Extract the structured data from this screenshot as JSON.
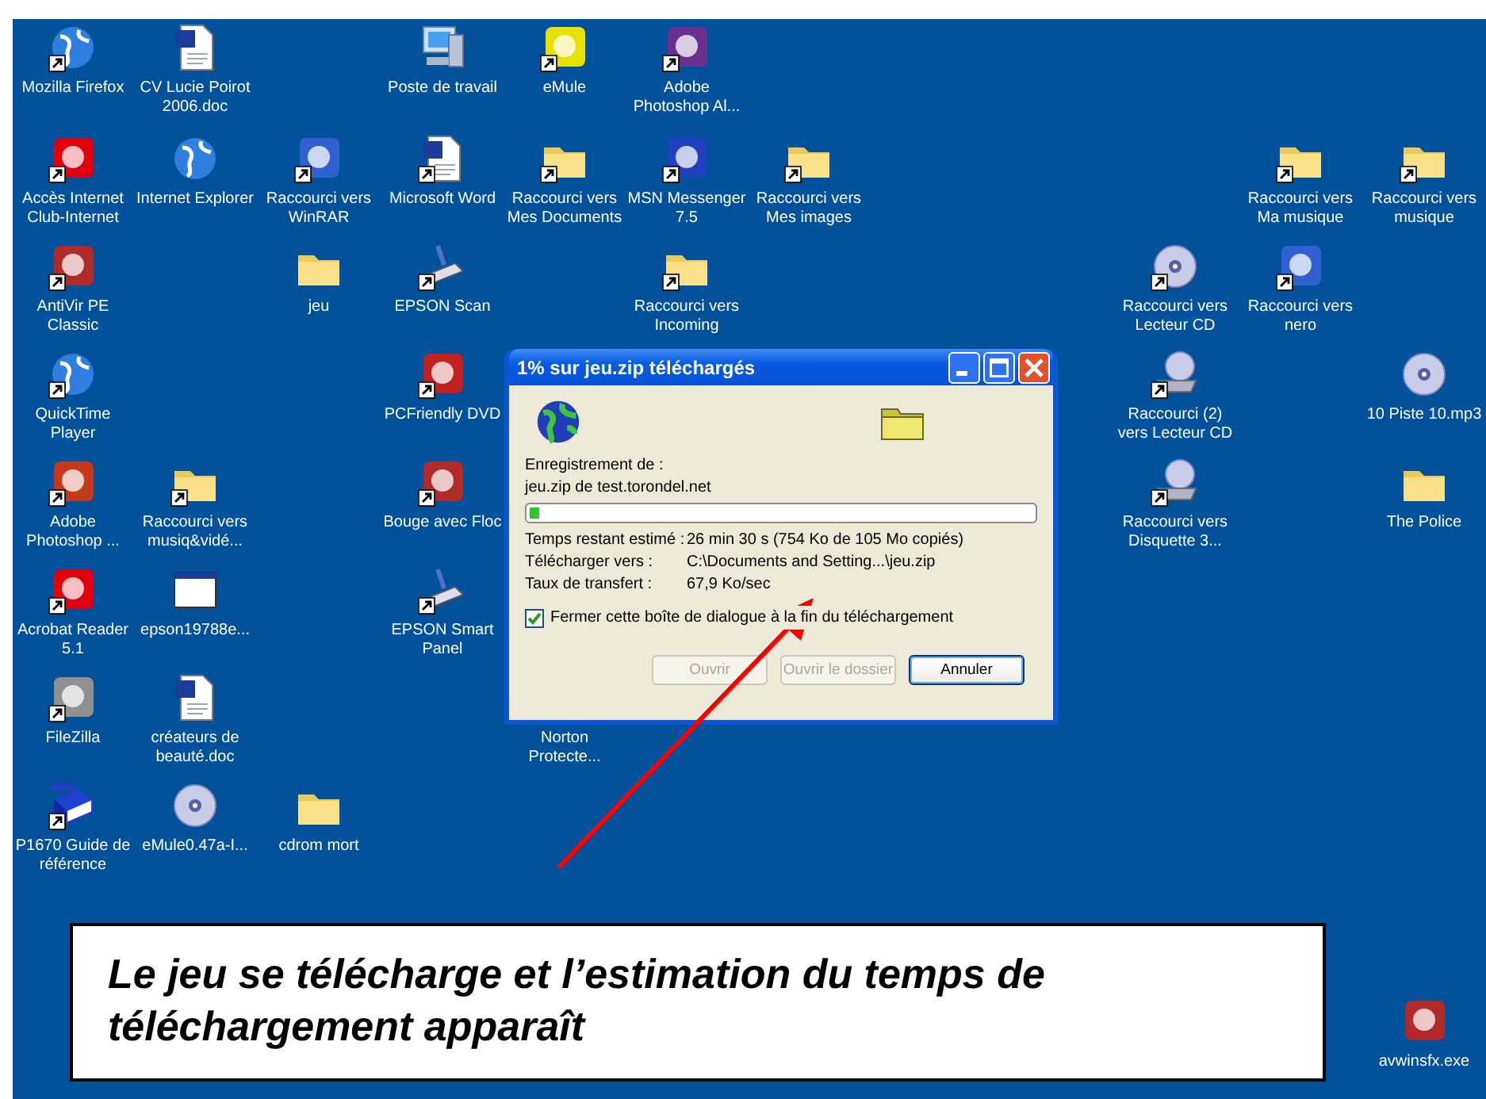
{
  "desktop_icons": [
    {
      "label": "Mozilla Firefox",
      "kind": "globe",
      "shortcut": true
    },
    {
      "label": "CV Lucie Poirot 2006.doc",
      "kind": "document",
      "shortcut": false
    },
    {
      "label": "Poste de travail",
      "kind": "computer",
      "shortcut": false
    },
    {
      "label": "eMule",
      "kind": "application",
      "shortcut": true
    },
    {
      "label": "Adobe Photoshop Al...",
      "kind": "application",
      "shortcut": true
    },
    {
      "label": "Accès Internet Club-Internet",
      "kind": "application",
      "shortcut": true
    },
    {
      "label": "Internet Explorer",
      "kind": "globe",
      "shortcut": false
    },
    {
      "label": "Raccourci vers WinRAR",
      "kind": "application",
      "shortcut": true
    },
    {
      "label": "Microsoft Word",
      "kind": "document",
      "shortcut": true
    },
    {
      "label": "Raccourci vers Mes Documents",
      "kind": "folder",
      "shortcut": true
    },
    {
      "label": "MSN Messenger 7.5",
      "kind": "application",
      "shortcut": true
    },
    {
      "label": "Raccourci vers Mes images",
      "kind": "folder",
      "shortcut": true
    },
    {
      "label": "Raccourci vers Ma musique",
      "kind": "folder",
      "shortcut": true
    },
    {
      "label": "Raccourci vers musique",
      "kind": "folder",
      "shortcut": true
    },
    {
      "label": "AntiVir PE Classic",
      "kind": "application",
      "shortcut": true
    },
    {
      "label": "jeu",
      "kind": "folder",
      "shortcut": false
    },
    {
      "label": "EPSON Scan",
      "kind": "scanner",
      "shortcut": true
    },
    {
      "label": "Raccourci vers Incoming",
      "kind": "folder",
      "shortcut": true
    },
    {
      "label": "Raccourci vers Lecteur CD",
      "kind": "disc",
      "shortcut": true
    },
    {
      "label": "Raccourci vers nero",
      "kind": "application",
      "shortcut": true
    },
    {
      "label": "QuickTime Player",
      "kind": "globe",
      "shortcut": true
    },
    {
      "label": "PCFriendly DVD",
      "kind": "application",
      "shortcut": true
    },
    {
      "label": "Raccourci (2) vers Lecteur CD",
      "kind": "drive",
      "shortcut": true
    },
    {
      "label": "10 Piste 10.mp3",
      "kind": "disc",
      "shortcut": false
    },
    {
      "label": "Adobe Photoshop ...",
      "kind": "application",
      "shortcut": true
    },
    {
      "label": "Raccourci vers musiq&vidé...",
      "kind": "folder",
      "shortcut": true
    },
    {
      "label": "Bouge avec Floc",
      "kind": "application",
      "shortcut": true
    },
    {
      "label": "Raccourci vers Disquette 3...",
      "kind": "drive",
      "shortcut": true
    },
    {
      "label": "The Police",
      "kind": "folder",
      "shortcut": false
    },
    {
      "label": "Acrobat Reader 5.1",
      "kind": "application",
      "shortcut": true
    },
    {
      "label": "epson19788e...",
      "kind": "window",
      "shortcut": false
    },
    {
      "label": "EPSON Smart Panel",
      "kind": "scanner",
      "shortcut": true
    },
    {
      "label": "FileZilla",
      "kind": "application",
      "shortcut": true
    },
    {
      "label": "créateurs de beauté.doc",
      "kind": "document",
      "shortcut": false
    },
    {
      "label": "Norton Protecte...",
      "kind": "hidden"
    },
    {
      "label": "P1670 Guide de référence",
      "kind": "book",
      "shortcut": true
    },
    {
      "label": "eMule0.47a-I...",
      "kind": "disc",
      "shortcut": false
    },
    {
      "label": "cdrom mort",
      "kind": "folder",
      "shortcut": false
    },
    {
      "label": "avwinsfx.exe",
      "kind": "application",
      "shortcut": false
    }
  ],
  "dialog": {
    "title": "1% sur jeu.zip téléchargés",
    "saving_label": "Enregistrement de :",
    "source": "jeu.zip de test.torondel.net",
    "progress": {
      "level": 0.01
    },
    "details": [
      {
        "label": "Temps restant estimé :",
        "value": "26 min 30 s (754 Ko de 105 Mo copiés)"
      },
      {
        "label": "Télécharger vers :",
        "value": "C:\\Documents and Setting...\\jeu.zip"
      },
      {
        "label": "Taux de transfert :",
        "value": "67,9 Ko/sec"
      }
    ],
    "close_when_done": {
      "label": "Fermer cette boîte de dialogue à la fin du téléchargement",
      "checked": true
    },
    "buttons": [
      {
        "label": "Ouvrir",
        "disabled": true,
        "default": false
      },
      {
        "label": "Ouvrir le dossier",
        "disabled": true,
        "default": false
      },
      {
        "label": "Annuler",
        "disabled": false,
        "default": true
      }
    ]
  },
  "caption": "Le jeu se télécharge et l’estimation du temps de téléchargement apparaît"
}
